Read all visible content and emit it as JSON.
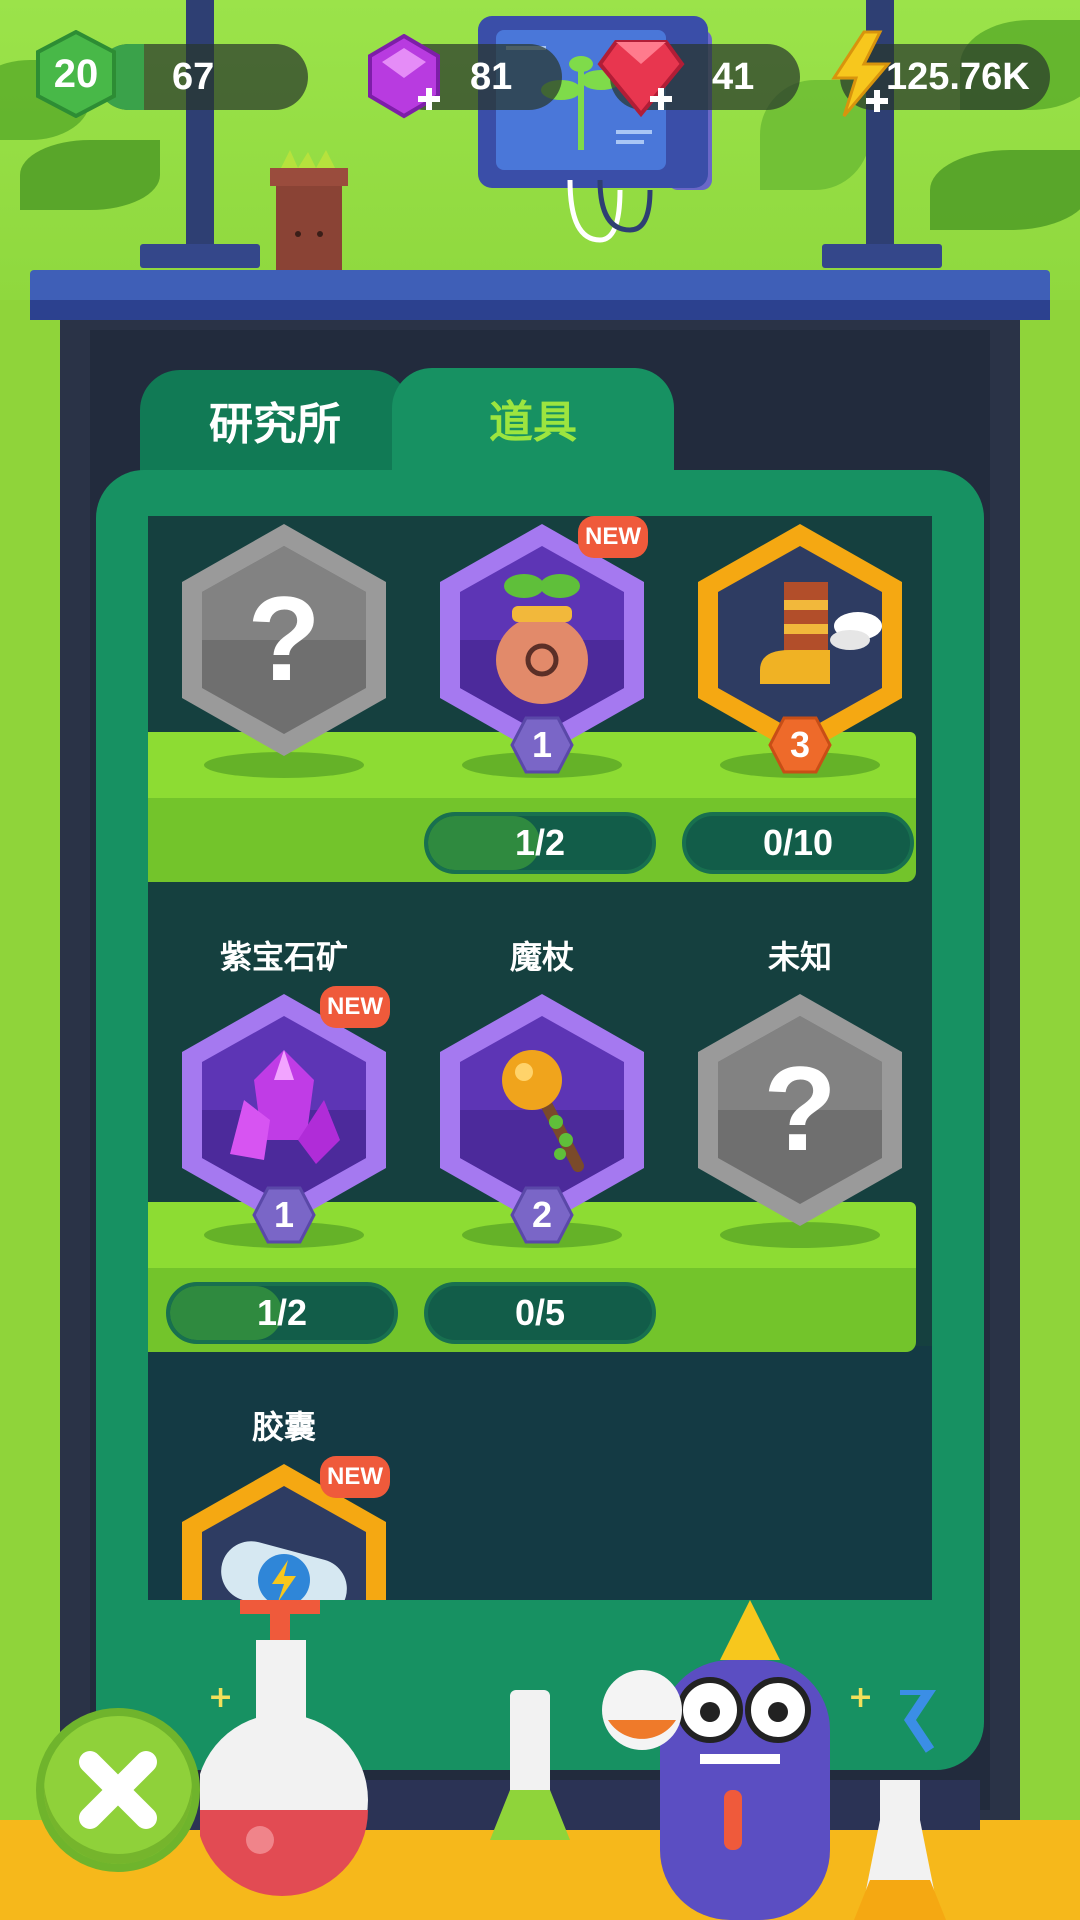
{
  "header": {
    "level": "20",
    "xp": "67",
    "purple_gems": "81",
    "red_gems": "41",
    "energy": "125.76K"
  },
  "tabs": [
    {
      "label": "研究所",
      "active": false
    },
    {
      "label": "道具",
      "active": true
    }
  ],
  "items": [
    {
      "name": "",
      "state": "unknown",
      "new": false,
      "level": null,
      "progress": null
    },
    {
      "name": "",
      "state": "seed-bag",
      "new": true,
      "new_label": "NEW",
      "level": "1",
      "progress": "1/2",
      "progress_fraction": 0.5
    },
    {
      "name": "",
      "state": "winged-boot",
      "new": false,
      "level": "3",
      "progress": "0/10",
      "progress_fraction": 0
    },
    {
      "name": "紫宝石矿",
      "state": "purple-crystal",
      "new": true,
      "new_label": "NEW",
      "level": "1",
      "progress": "1/2",
      "progress_fraction": 0.5
    },
    {
      "name": "魔杖",
      "state": "magic-wand",
      "new": false,
      "level": "2",
      "progress": "0/5",
      "progress_fraction": 0
    },
    {
      "name": "未知",
      "state": "unknown",
      "new": false,
      "level": null,
      "progress": null
    },
    {
      "name": "胶囊",
      "state": "energy-capsule",
      "new": true,
      "new_label": "NEW",
      "level": null,
      "progress": null
    }
  ],
  "colors": {
    "tab_active_text": "#9ce53f",
    "panel": "#179162",
    "shelf": "#8ddc33",
    "new_badge": "#ef5a3b",
    "frame_gold": "#f5a812",
    "frame_purple": "#8b5fe0",
    "frame_grey": "#9a9a9a"
  }
}
